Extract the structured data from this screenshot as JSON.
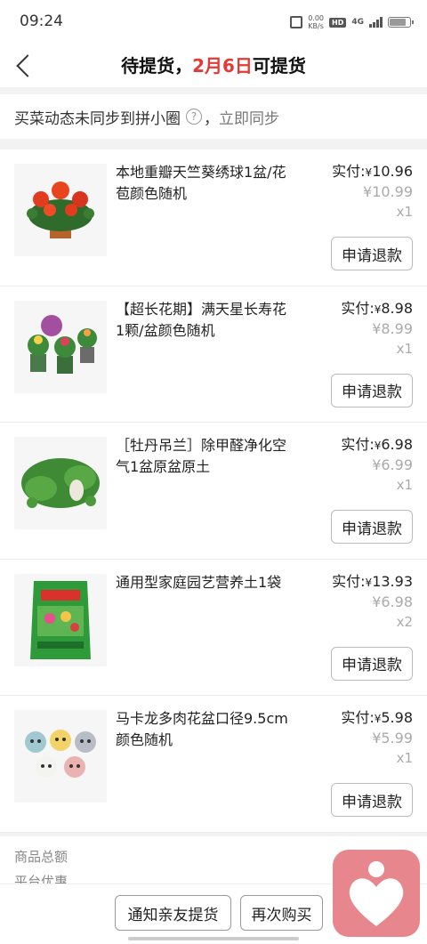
{
  "status_bar": {
    "time": "09:24",
    "net_speed_value": "0.00",
    "net_speed_unit": "KB/s",
    "hd": "HD",
    "network": "4G",
    "battery_level": 0.85
  },
  "header": {
    "title_prefix": "待提货，",
    "title_date": "2月6日",
    "title_suffix": "可提货"
  },
  "sync": {
    "text": "买菜动态未同步到拼小圈",
    "help_symbol": "?",
    "separator": "，",
    "link": "立即同步"
  },
  "items": [
    {
      "name": "本地重瓣天竺葵绣球1盆/花苞颜色随机",
      "paid_label": "实付:",
      "currency": "¥",
      "paid": "10.96",
      "original": "¥10.99",
      "qty": "x1",
      "refund_label": "申请退款",
      "thumb": "geranium"
    },
    {
      "name": "【超长花期】满天星长寿花1颗/盆颜色随机",
      "paid_label": "实付:",
      "currency": "¥",
      "paid": "8.98",
      "original": "¥8.99",
      "qty": "x1",
      "refund_label": "申请退款",
      "thumb": "kalanchoe"
    },
    {
      "name": "［牡丹吊兰］除甲醛净化空气1盆原盆原土",
      "paid_label": "实付:",
      "currency": "¥",
      "paid": "6.98",
      "original": "¥6.99",
      "qty": "x1",
      "refund_label": "申请退款",
      "thumb": "ivy"
    },
    {
      "name": "通用型家庭园艺营养土1袋",
      "paid_label": "实付:",
      "currency": "¥",
      "paid": "13.93",
      "original": "¥6.98",
      "qty": "x2",
      "refund_label": "申请退款",
      "thumb": "soil"
    },
    {
      "name": "马卡龙多肉花盆口径9.5cm颜色随机",
      "paid_label": "实付:",
      "currency": "¥",
      "paid": "5.98",
      "original": "¥5.99",
      "qty": "x1",
      "refund_label": "申请退款",
      "thumb": "pots"
    }
  ],
  "summary": {
    "total_label": "商品总额",
    "discount_label": "平台优惠"
  },
  "bottom": {
    "notify_label": "通知亲友提货",
    "rebuy_label": "再次购买"
  },
  "colors": {
    "accent_red": "#e53935",
    "float_badge": "#e8868d"
  }
}
